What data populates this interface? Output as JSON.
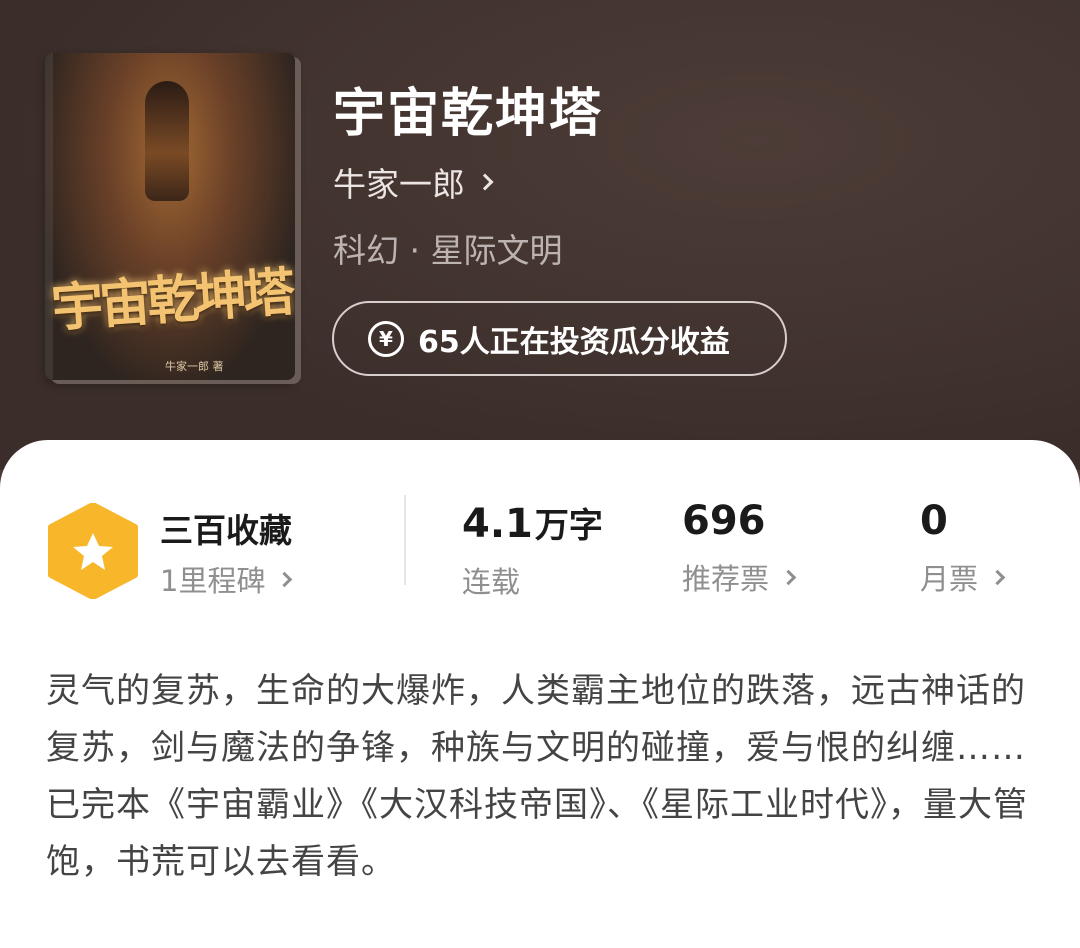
{
  "book": {
    "cover_title": "宇宙乾坤塔",
    "cover_author": "牛家一郎 著",
    "title": "宇宙乾坤塔",
    "author": "牛家一郎",
    "genre": "科幻 · 星际文明",
    "invest_text": "65人正在投资瓜分收益",
    "invest_icon": "yen-circle-icon"
  },
  "stats": {
    "milestone_title": "三百收藏",
    "milestone_sub": "1里程碑",
    "badge_icon": "star-hexagon-icon",
    "badge_color": "#f8b62b",
    "words_value": "4.1",
    "words_unit": "万字",
    "words_label": "连载",
    "recommend_value": "696",
    "recommend_label": "推荐票",
    "monthly_value": "0",
    "monthly_label": "月票"
  },
  "intro": {
    "paragraph1": "灵气的复苏，生命的大爆炸，人类霸主地位的跌落，远古神话的复苏，剑与魔法的争锋，种族与文明的碰撞，爱与恨的纠缠……",
    "paragraph2": "已完本《宇宙霸业》《大汉科技帝国》、《星际工业时代》，量大管饱，书荒可以去看看。"
  }
}
